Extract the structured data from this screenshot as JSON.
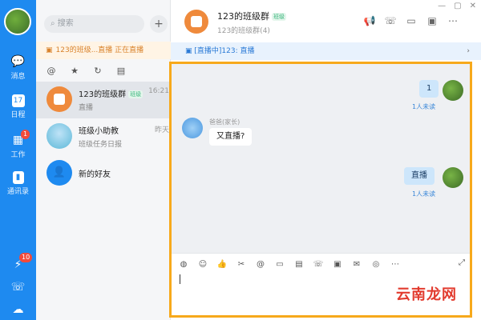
{
  "rail": {
    "items": [
      {
        "label": "消息",
        "icon": "chat-bubble-icon"
      },
      {
        "label": "日程",
        "icon": "calendar-icon",
        "day": "17"
      },
      {
        "label": "工作",
        "icon": "apps-grid-icon",
        "badge": "1"
      },
      {
        "label": "通讯录",
        "icon": "contacts-icon"
      }
    ],
    "bottom_badge": "10"
  },
  "list": {
    "search_placeholder": "搜索",
    "live_bar": "123的班级...直播 正在直播",
    "conversations": [
      {
        "name": "123的班级群",
        "tag": "班级",
        "preview": "直播",
        "time": "16:21",
        "active": true
      },
      {
        "name": "班级小助教",
        "preview": "班级任务日报",
        "time": "昨天"
      },
      {
        "name": "新的好友",
        "preview": ""
      }
    ]
  },
  "header": {
    "title": "123的班级群",
    "tag": "班级",
    "subtitle": "123的班级群(4)"
  },
  "live_strip": "[直播中]123: 直播",
  "messages": [
    {
      "dir": "out",
      "text": "1",
      "status": "1人未读"
    },
    {
      "dir": "in",
      "sender": "爸爸(家长)",
      "text": "又直播?"
    },
    {
      "dir": "out",
      "text": "直播",
      "status": "1人未读"
    }
  ],
  "watermark": "云南龙网",
  "colors": {
    "accent": "#1e8af0",
    "frame": "#f7a91b",
    "live": "#d9822b"
  }
}
